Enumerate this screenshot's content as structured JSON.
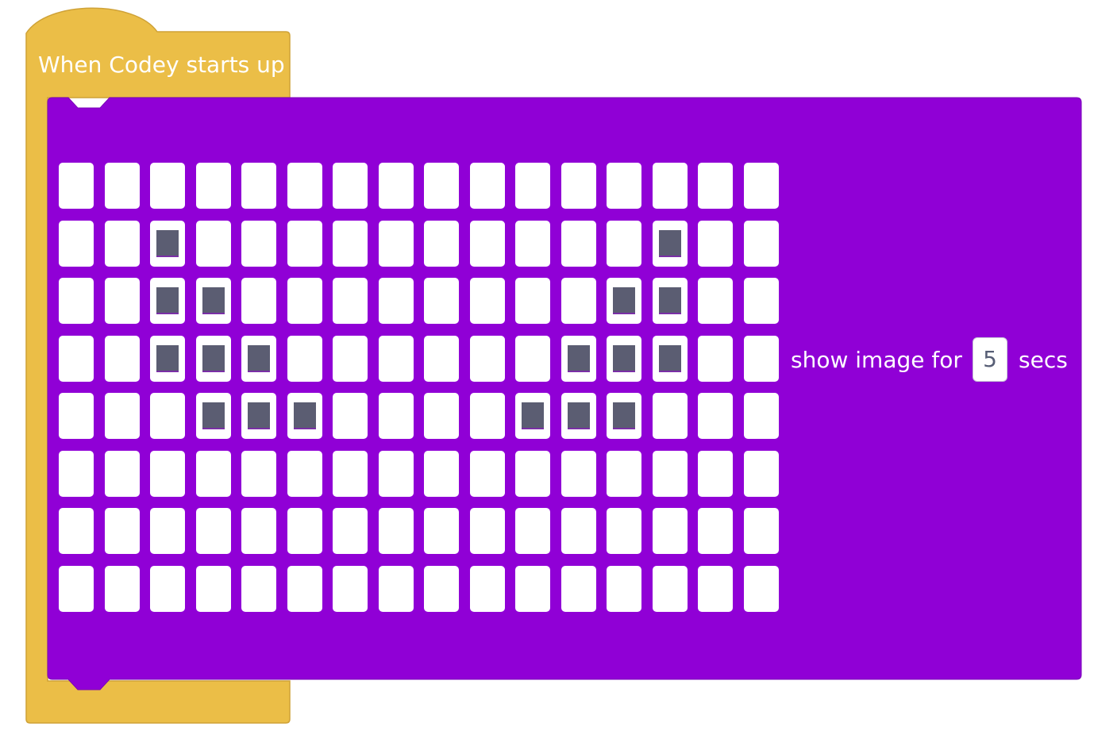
{
  "hat_block": {
    "label": "When Codey starts up",
    "color": "#EBBE47",
    "border_color": "#CFA237"
  },
  "show_image_block": {
    "color": "#9000D6",
    "prefix_label": "show image for",
    "seconds_value": "5",
    "suffix_label": "secs",
    "led_on_color": "#5B5D72",
    "led_off_color": "#FFFFFF",
    "led_matrix": {
      "columns": 16,
      "rows": 8,
      "pattern": [
        "0000000000000000",
        "0010000000000100",
        "0011000000001100",
        "0011100000011100",
        "0001110000111000",
        "0000000000000000",
        "0000000000000000",
        "0000000000000000"
      ]
    }
  }
}
